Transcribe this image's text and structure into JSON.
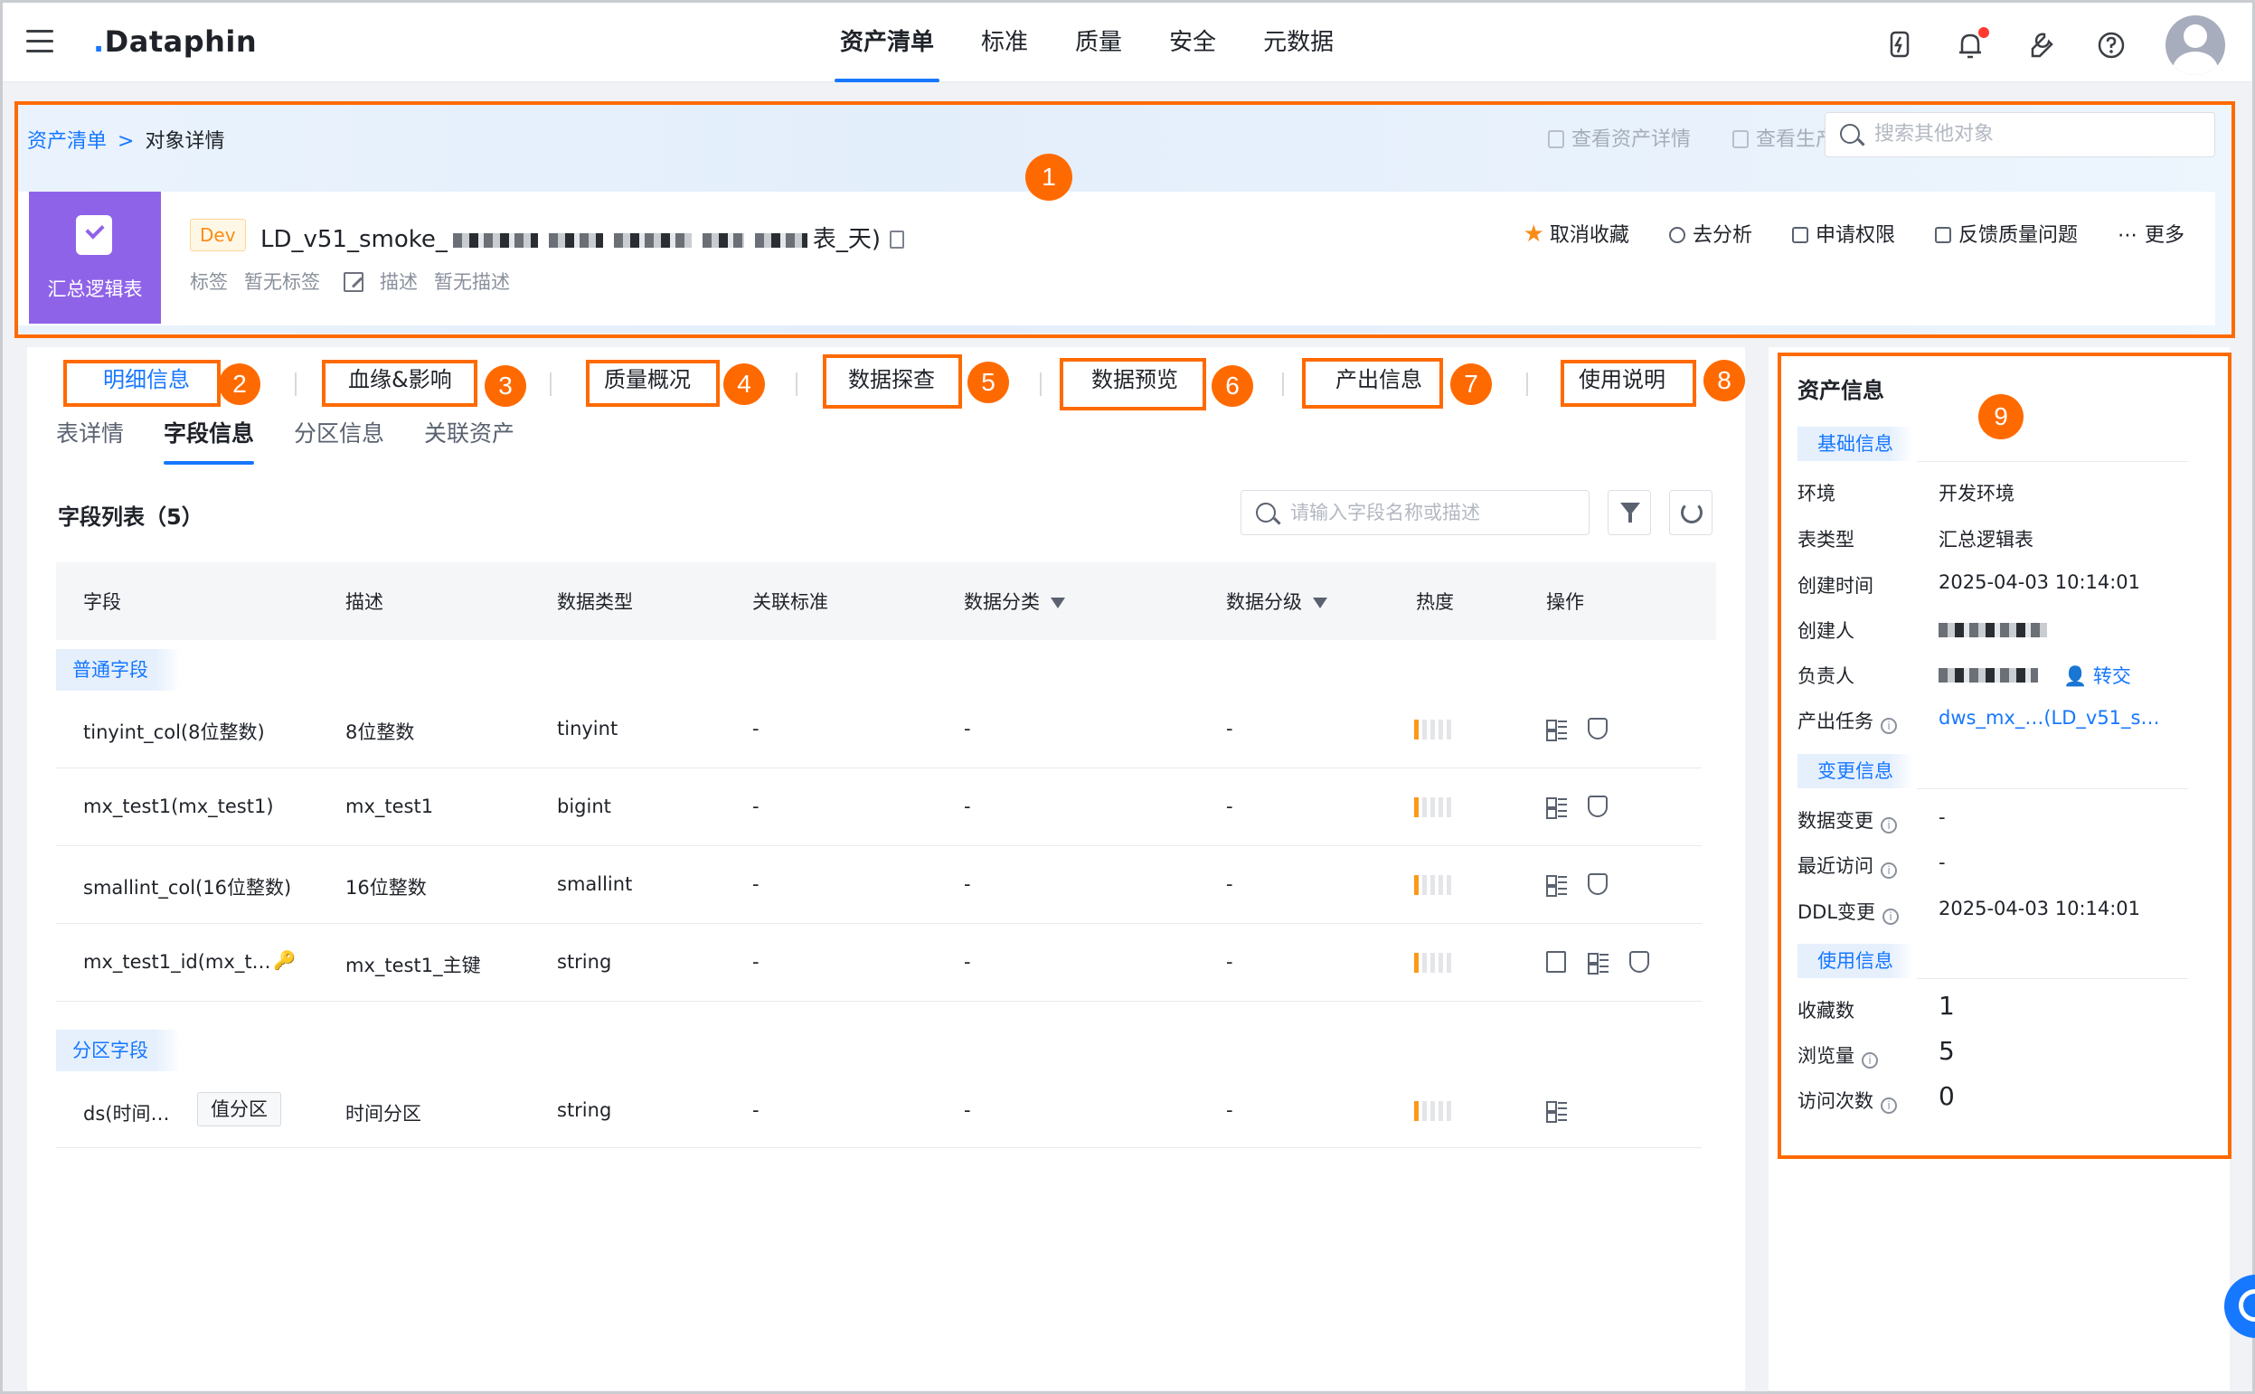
{
  "nav": {
    "logo": "Dataphin",
    "tabs": [
      "资产清单",
      "标准",
      "质量",
      "安全",
      "元数据"
    ],
    "active_tab": "资产清单"
  },
  "breadcrumb": {
    "root": "资产清单",
    "sep": ">",
    "current": "对象详情"
  },
  "header_actions": {
    "view_asset": "查看资产详情",
    "view_prod": "查看生产对象"
  },
  "search_obj": {
    "placeholder": "搜索其他对象"
  },
  "object": {
    "type_label": "汇总逻辑表",
    "env_tag": "Dev",
    "name_prefix": "LD_v51_smoke_",
    "name_suffix": "表_天)",
    "tag_label": "标签",
    "tag_value": "暂无标签",
    "desc_label": "描述",
    "desc_value": "暂无描述",
    "actions": [
      "取消收藏",
      "去分析",
      "申请权限",
      "反馈质量问题",
      "更多"
    ]
  },
  "top_tabs": [
    "明细信息",
    "血缘&影响",
    "质量概况",
    "数据探查",
    "数据预览",
    "产出信息",
    "使用说明"
  ],
  "sub_tabs": [
    "表详情",
    "字段信息",
    "分区信息",
    "关联资产"
  ],
  "field_list": {
    "title": "字段列表（5）",
    "search_placeholder": "请输入字段名称或描述",
    "columns": [
      "字段",
      "描述",
      "数据类型",
      "关联标准",
      "数据分类",
      "数据分级",
      "热度",
      "操作"
    ],
    "normal_group": "普通字段",
    "partition_group": "分区字段",
    "rows": [
      {
        "field": "tinyint_col(8位整数)",
        "desc": "8位整数",
        "type": "tinyint",
        "std": "-",
        "cls": "-",
        "lvl": "-",
        "heat": 1
      },
      {
        "field": "mx_test1(mx_test1)",
        "desc": "mx_test1",
        "type": "bigint",
        "std": "-",
        "cls": "-",
        "lvl": "-",
        "heat": 1
      },
      {
        "field": "smallint_col(16位整数)",
        "desc": "16位整数",
        "type": "smallint",
        "std": "-",
        "cls": "-",
        "lvl": "-",
        "heat": 1
      },
      {
        "field": "mx_test1_id(mx_t…",
        "desc": "mx_test1_主键",
        "type": "string",
        "std": "-",
        "cls": "-",
        "lvl": "-",
        "heat": 1
      }
    ],
    "partition_row": {
      "field": "ds(时间…",
      "tag": "值分区",
      "desc": "时间分区",
      "type": "string",
      "std": "-",
      "cls": "-",
      "lvl": "-",
      "heat": 1
    }
  },
  "asset_info": {
    "title": "资产信息",
    "basic_title": "基础信息",
    "basic": [
      {
        "k": "环境",
        "v": "开发环境"
      },
      {
        "k": "表类型",
        "v": "汇总逻辑表"
      },
      {
        "k": "创建时间",
        "v": "2025-04-03 10:14:01"
      },
      {
        "k": "创建人",
        "v": ""
      },
      {
        "k": "负责人",
        "v": "",
        "action": "转交"
      },
      {
        "k": "产出任务",
        "v": "dws_mx_…(LD_v51_s…"
      }
    ],
    "change_title": "变更信息",
    "change": [
      {
        "k": "数据变更",
        "v": "-"
      },
      {
        "k": "最近访问",
        "v": "-"
      },
      {
        "k": "DDL变更",
        "v": "2025-04-03 10:14:01"
      }
    ],
    "usage_title": "使用信息",
    "usage": [
      {
        "k": "收藏数",
        "v": "1"
      },
      {
        "k": "浏览量",
        "v": "5"
      },
      {
        "k": "访问次数",
        "v": "0"
      }
    ]
  },
  "annotations": [
    "1",
    "2",
    "3",
    "4",
    "5",
    "6",
    "7",
    "8",
    "9"
  ],
  "colors": {
    "accent": "#1677ff",
    "annotation": "#ff6a00",
    "object_icon": "#8f63e8",
    "heat": "#fa9a18"
  }
}
